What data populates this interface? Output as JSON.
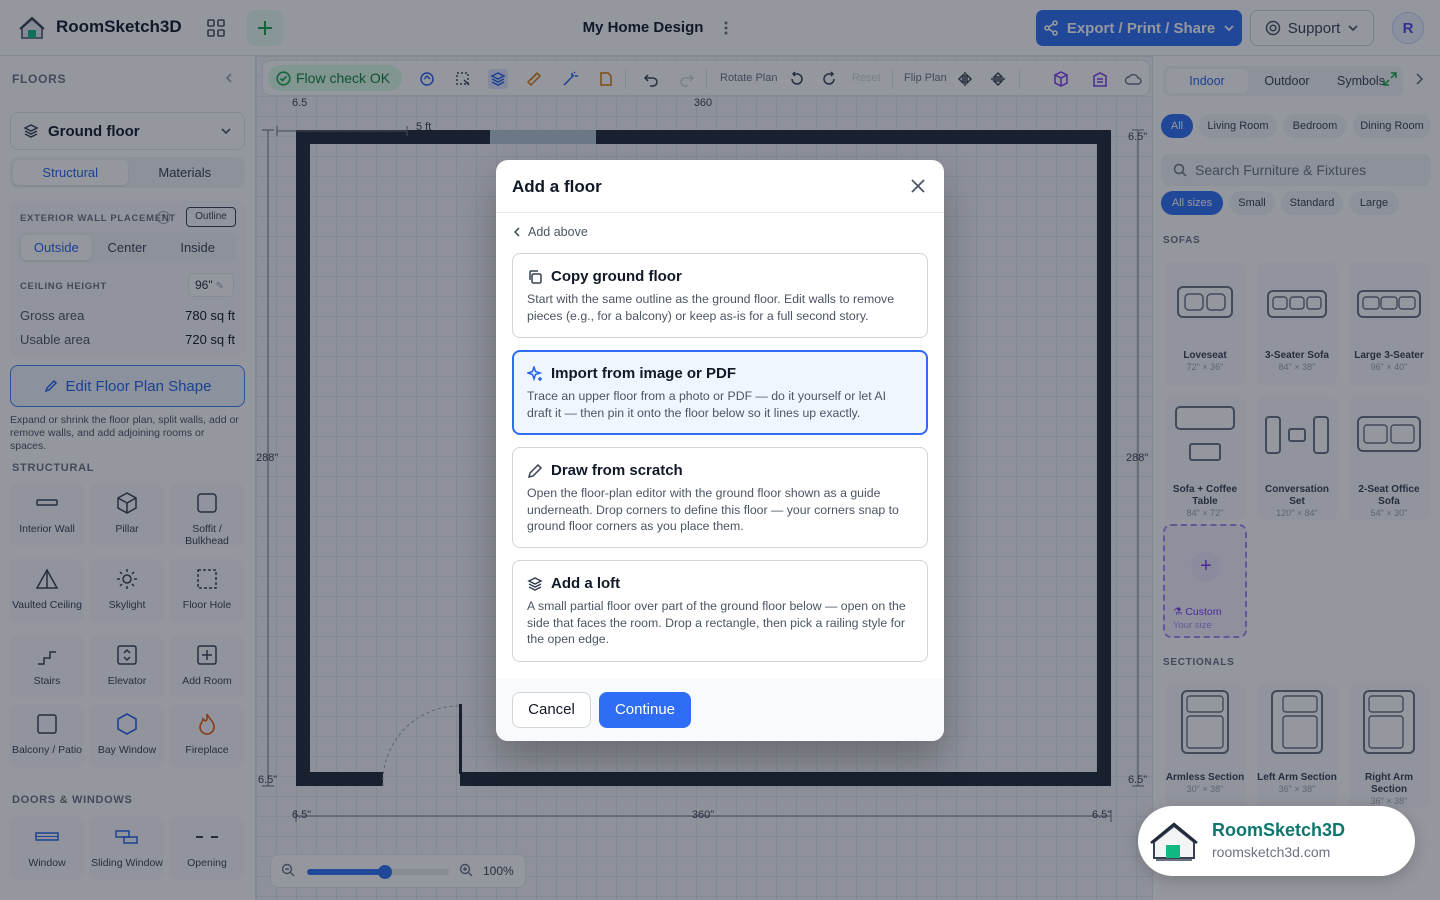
{
  "header": {
    "app_name": "RoomSketch3D",
    "doc_title": "My Home Design",
    "export_label": "Export / Print / Share",
    "support_label": "Support",
    "avatar_initial": "R"
  },
  "left": {
    "section_title": "FLOORS",
    "floor_selected": "Ground floor",
    "tabs": [
      "Structural",
      "Materials"
    ],
    "wall_placement_label": "EXTERIOR WALL PLACEMENT",
    "wall_placement_badge": "Outline",
    "placement_options": [
      "Outside",
      "Center",
      "Inside"
    ],
    "ceiling_label": "CEILING HEIGHT",
    "ceiling_value": "96\"",
    "gross_label": "Gross area",
    "gross_value": "780 sq ft",
    "usable_label": "Usable area",
    "usable_value": "720 sq ft",
    "edit_shape_label": "Edit Floor Plan Shape",
    "edit_help": "Expand or shrink the floor plan, split walls, add or remove walls, and add adjoining rooms or spaces.",
    "structural_title": "STRUCTURAL",
    "structural_tools": [
      "Interior Wall",
      "Pillar",
      "Soffit / Bulkhead",
      "Vaulted Ceiling",
      "Skylight",
      "Floor Hole",
      "Stairs",
      "Elevator",
      "Add Room",
      "Balcony / Patio",
      "Bay Window",
      "Fireplace"
    ],
    "doors_title": "DOORS & WINDOWS",
    "door_tools": [
      "Window",
      "Sliding Window",
      "Opening"
    ]
  },
  "toolbar": {
    "flow_check": "Flow check OK",
    "rotate_label": "Rotate Plan",
    "reset_label": "Reset",
    "flip_label": "Flip Plan"
  },
  "canvas": {
    "scale_label": "5 ft",
    "dim_top": "360",
    "dim_bottom": "360\"",
    "dim_left": "288\"",
    "dim_right": "288\"",
    "dim_corner": "6.5\"",
    "dim_corner_tl": "6.5",
    "zoom_value": 0.55,
    "zoom_label": "100%"
  },
  "right": {
    "tabs": [
      "Indoor",
      "Outdoor",
      "Symbols"
    ],
    "room_chips": [
      "All",
      "Living Room",
      "Bedroom",
      "Dining Room"
    ],
    "search_placeholder": "Search Furniture & Fixtures",
    "size_chips": [
      "All sizes",
      "Small",
      "Standard",
      "Large"
    ],
    "sofas_title": "SOFAS",
    "sofas": [
      {
        "name": "Loveseat",
        "size": "72\" × 36\""
      },
      {
        "name": "3-Seater Sofa",
        "size": "84\" × 38\""
      },
      {
        "name": "Large 3-Seater",
        "size": "96\" × 40\""
      },
      {
        "name": "Sofa + Coffee Table",
        "size": "84\" × 72\""
      },
      {
        "name": "Conversation Set",
        "size": "120\" × 84\""
      },
      {
        "name": "2-Seat Office Sofa",
        "size": "54\" × 30\""
      }
    ],
    "custom_label": "Custom",
    "custom_sub": "Your size",
    "sectionals_title": "SECTIONALS",
    "sectionals": [
      {
        "name": "Armless Section",
        "size": "30\" × 38\""
      },
      {
        "name": "Left Arm Section",
        "size": "36\" × 38\""
      },
      {
        "name": "Right Arm Section",
        "size": "36\" × 38\""
      }
    ]
  },
  "modal": {
    "title": "Add a floor",
    "back_label": "Add above",
    "options": [
      {
        "title": "Copy ground floor",
        "desc": "Start with the same outline as the ground floor. Edit walls to remove pieces (e.g., for a balcony) or keep as-is for a full second story.",
        "icon": "copy-icon"
      },
      {
        "title": "Import from image or PDF",
        "desc": "Trace an upper floor from a photo or PDF — do it yourself or let AI draft it — then pin it onto the floor below so it lines up exactly.",
        "icon": "sparkle-icon"
      },
      {
        "title": "Draw from scratch",
        "desc": "Open the floor-plan editor with the ground floor shown as a guide underneath. Drop corners to define this floor — your corners snap to ground floor corners as you place them.",
        "icon": "pencil-icon"
      },
      {
        "title": "Add a loft",
        "desc": "A small partial floor over part of the ground floor below — open on the side that faces the room. Drop a rectangle, then pick a railing style for the open edge.",
        "icon": "layers-icon"
      }
    ],
    "selected_index": 1,
    "cancel_label": "Cancel",
    "continue_label": "Continue"
  },
  "brand": {
    "name": "RoomSketch3D",
    "url": "roomsketch3d.com"
  },
  "colors": {
    "accent": "#2f6df6",
    "wall": "#1f2937",
    "success": "#16a34a",
    "purple": "#7c3aed"
  }
}
